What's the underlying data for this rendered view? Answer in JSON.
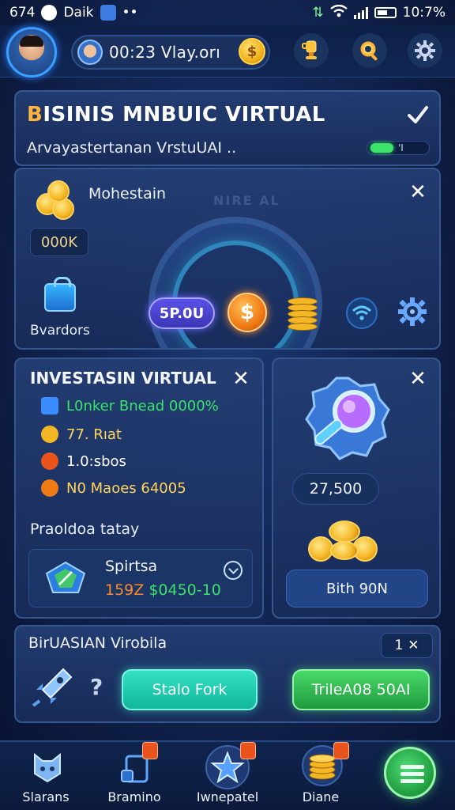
{
  "status_bar": {
    "left_text": "674",
    "app_text": "Daik",
    "time": "10:7%"
  },
  "header": {
    "player_name": "00:23 Vlay.orı",
    "coin_symbol": "$"
  },
  "title_panel": {
    "title_first": "B",
    "title_rest": "ISINIS MNBUIC VIRTUAL",
    "subtitle": "Arvayastertanan VrstuUAI ..",
    "progress_label": "'I",
    "progress_fraction": 0.45
  },
  "money_panel": {
    "watermark": "NIRE AL",
    "label": "Mohestain",
    "value": "000K",
    "bag_label": "Bvardors",
    "amount_label": "5P.0U",
    "dollar_symbol": "$"
  },
  "invest_panel": {
    "title": "INVESTASIN VIRTUAL",
    "rows": [
      {
        "text": "L0nker Bnead 0000%",
        "color": "#3be36a",
        "icon_color": "#3a8cff"
      },
      {
        "text": "77. Rıat",
        "color": "#ffd75a",
        "icon_color": "#f3b624"
      },
      {
        "text": "1.0:sbos",
        "color": "#ffffff",
        "icon_color": "#e8541c"
      },
      {
        "text": "N0 Maoes 64005",
        "color": "#ffd75a",
        "icon_color": "#f07a13"
      }
    ],
    "subheading": "Praoldoa tatay",
    "card": {
      "title": "Spirtsa",
      "value_a": "159Z",
      "value_b": "$0450-10"
    }
  },
  "search_panel": {
    "value": "27,500",
    "buy_label": "Bith 90N"
  },
  "bottom_panel": {
    "title": "BirUASIAN Virobila",
    "close_label": "1",
    "question": "?",
    "teal_button": "Stalo Fork",
    "green_button": "TrileA08 50AI"
  },
  "nav": [
    {
      "label": "Slarans",
      "icon": "cat-icon",
      "badge": false
    },
    {
      "label": "Bramino",
      "icon": "tablet-icon",
      "badge": true
    },
    {
      "label": "Iwnepatel",
      "icon": "star-icon",
      "badge": true
    },
    {
      "label": "Diane",
      "icon": "coins-icon",
      "badge": true
    }
  ],
  "colors": {
    "accent_orange": "#ffb43b",
    "accent_green": "#3be36a",
    "accent_teal": "#33e0c3",
    "panel_border": "#35568f"
  }
}
